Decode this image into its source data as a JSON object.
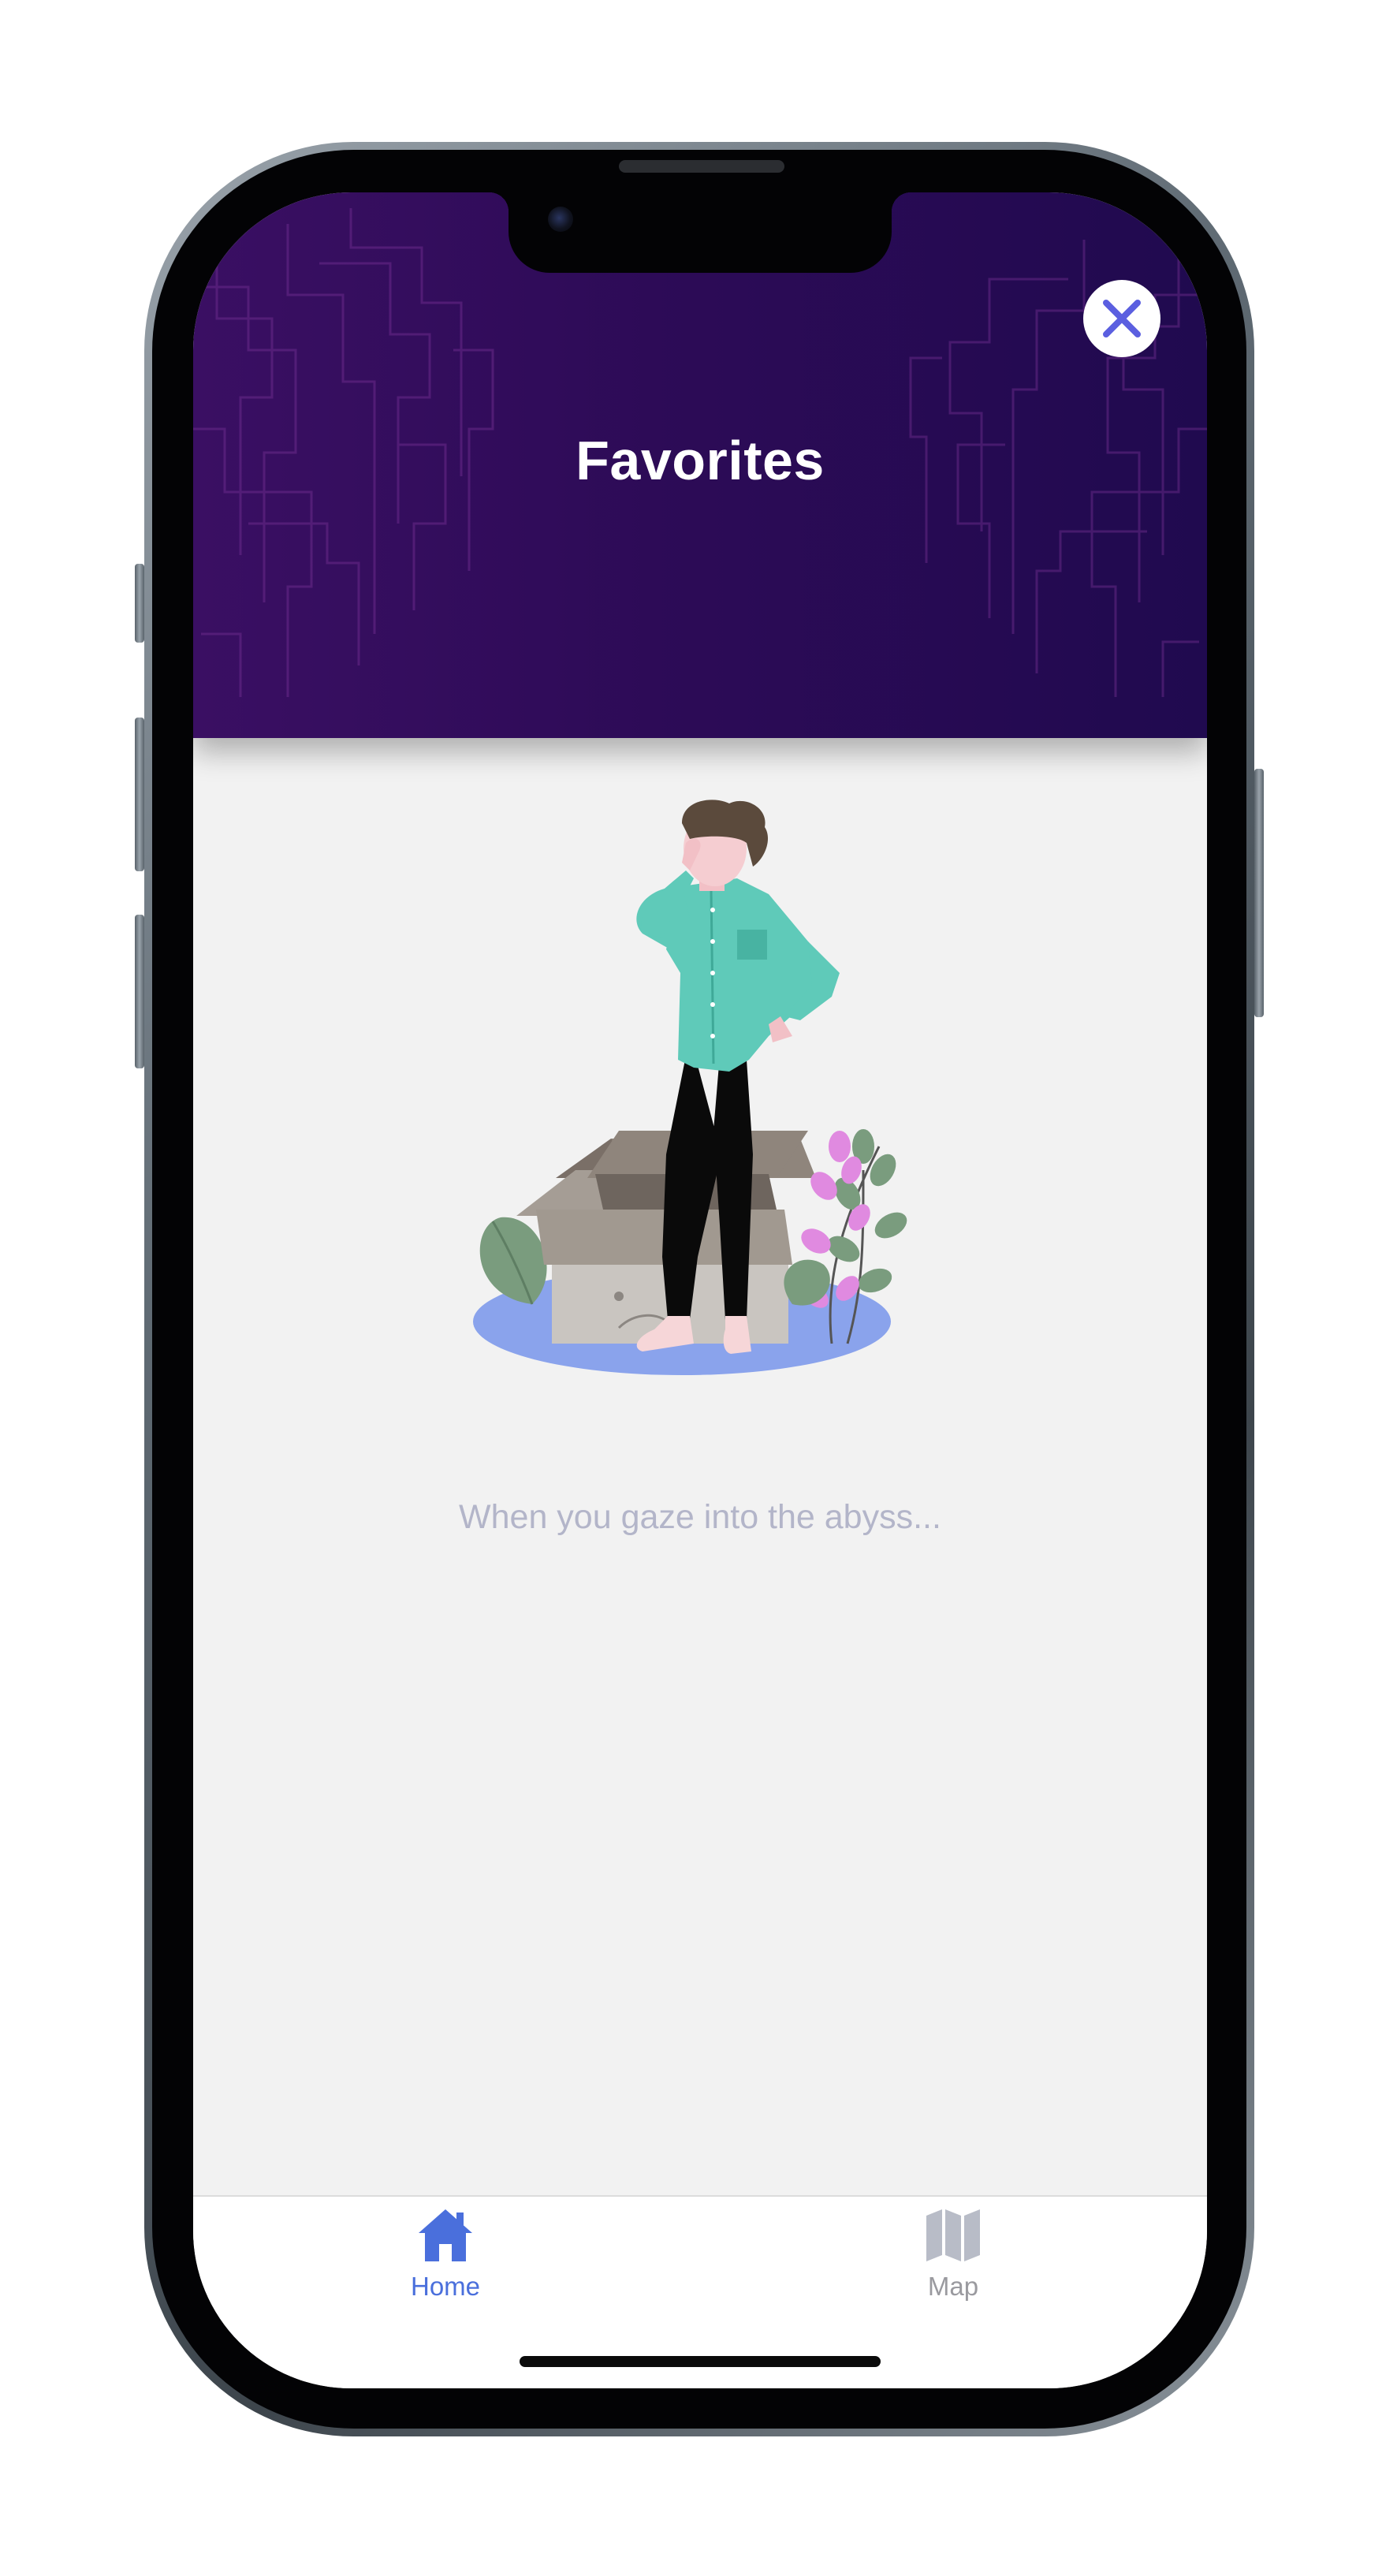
{
  "header": {
    "title": "Favorites",
    "close_icon": "close-x-icon"
  },
  "empty_state": {
    "illustration_icon": "empty-box-person-illustration",
    "message": "When you gaze into the abyss..."
  },
  "tabbar": {
    "items": [
      {
        "label": "Home",
        "icon": "home-icon",
        "active": true
      },
      {
        "label": "Map",
        "icon": "map-icon",
        "active": false
      }
    ]
  },
  "colors": {
    "header_gradient_start": "#3a0f63",
    "header_gradient_end": "#200a4f",
    "accent_blue": "#4a6fdc",
    "close_icon": "#5b5fe0",
    "inactive_tab": "#9a9a9f",
    "empty_text": "#b3b5c9"
  }
}
